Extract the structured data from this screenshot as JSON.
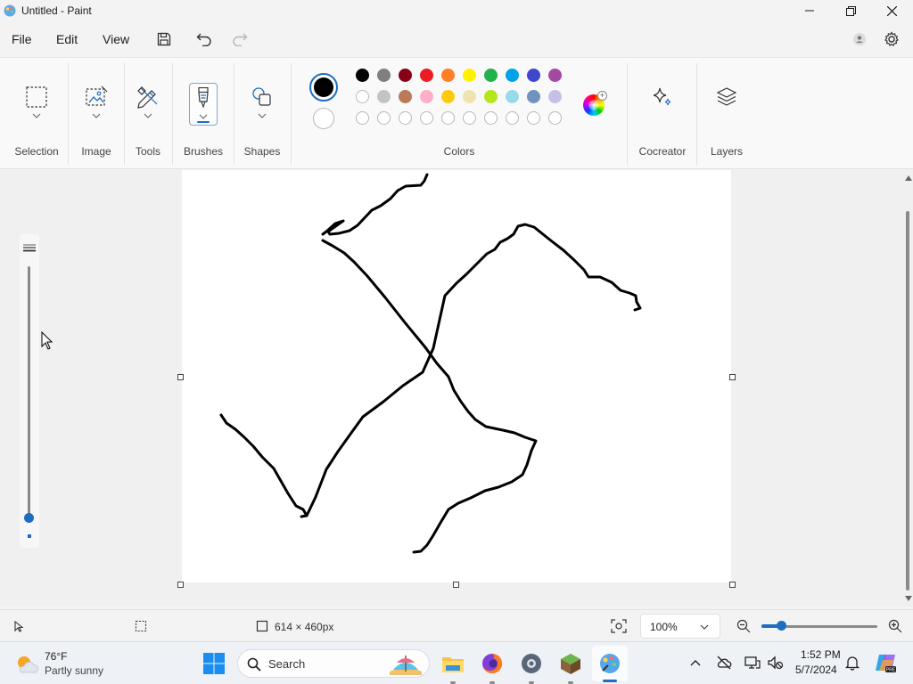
{
  "window": {
    "title": "Untitled - Paint"
  },
  "menu": {
    "file": "File",
    "edit": "Edit",
    "view": "View"
  },
  "ribbon": {
    "groups": {
      "selection": "Selection",
      "image": "Image",
      "tools": "Tools",
      "brushes": "Brushes",
      "shapes": "Shapes",
      "colors": "Colors",
      "cocreator": "Cocreator",
      "layers": "Layers"
    },
    "primary_color": "#000000",
    "secondary_color": "#ffffff",
    "palette_row1": [
      "#000000",
      "#7f7f7f",
      "#880015",
      "#ed1c24",
      "#ff7f27",
      "#fff200",
      "#22b14c",
      "#00a2e8",
      "#3f48cc",
      "#a349a4"
    ],
    "palette_row2": [
      "#ffffff",
      "#c3c3c3",
      "#b97a57",
      "#ffaec9",
      "#ffc90e",
      "#efe4b0",
      "#b5e61d",
      "#99d9ea",
      "#7092be",
      "#c8bfe7"
    ],
    "palette_row3_empty_count": 10
  },
  "canvas": {
    "background": "#ffffff",
    "stroke_color": "#000000",
    "brush_size_level": 0.02
  },
  "status": {
    "canvas_size": "614 × 460px",
    "zoom": "100%",
    "zoom_level": 0.17
  },
  "taskbar": {
    "weather_temp": "76°F",
    "weather_desc": "Partly sunny",
    "search_placeholder": "Search",
    "time": "1:52 PM",
    "date": "5/7/2024"
  },
  "accent": "#1e6dc2"
}
